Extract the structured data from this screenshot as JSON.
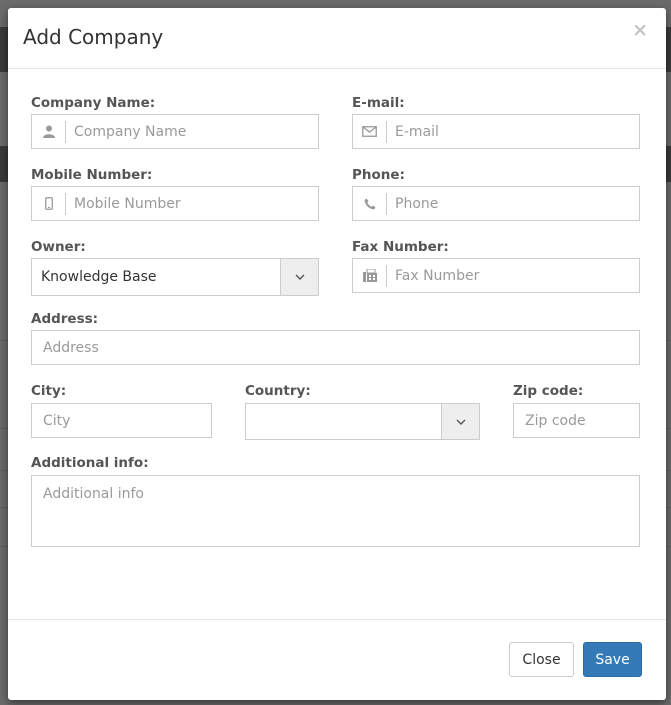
{
  "modal": {
    "title": "Add Company",
    "close_glyph": "×"
  },
  "fields": {
    "company_name": {
      "label": "Company Name:",
      "placeholder": "Company Name",
      "icon": "user-icon"
    },
    "email": {
      "label": "E-mail:",
      "placeholder": "E-mail",
      "icon": "envelope-icon"
    },
    "mobile": {
      "label": "Mobile Number:",
      "placeholder": "Mobile Number",
      "icon": "mobile-icon"
    },
    "phone": {
      "label": "Phone:",
      "placeholder": "Phone",
      "icon": "phone-icon"
    },
    "owner": {
      "label": "Owner:",
      "value": "Knowledge Base"
    },
    "fax": {
      "label": "Fax Number:",
      "placeholder": "Fax Number",
      "icon": "fax-icon"
    },
    "address": {
      "label": "Address:",
      "placeholder": "Address"
    },
    "city": {
      "label": "City:",
      "placeholder": "City"
    },
    "country": {
      "label": "Country:",
      "value": ""
    },
    "zip": {
      "label": "Zip code:",
      "placeholder": "Zip code"
    },
    "additional_info": {
      "label": "Additional info:",
      "placeholder": "Additional info"
    }
  },
  "footer": {
    "close_label": "Close",
    "save_label": "Save"
  },
  "colors": {
    "primary": "#337ab7",
    "border": "#cccccc",
    "label": "#555555",
    "placeholder": "#9a9a9a"
  }
}
